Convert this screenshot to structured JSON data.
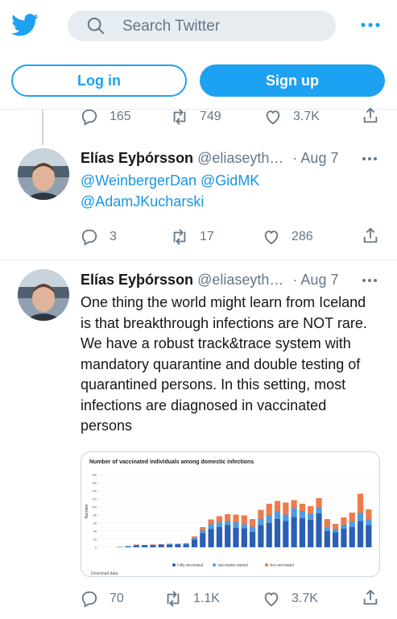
{
  "header": {
    "search_placeholder": "Search Twitter"
  },
  "auth": {
    "login_label": "Log in",
    "signup_label": "Sign up"
  },
  "prev_tweet_actions": {
    "replies": "165",
    "retweets": "749",
    "likes": "3.7K"
  },
  "tweets": [
    {
      "name": "Elías Eyþórsson",
      "handle": "@eliaseyth…",
      "date": "· Aug 7",
      "mention1": "@WeinbergerDan",
      "mention2": "@GidMK",
      "mention3": "@AdamJKucharski",
      "replies": "3",
      "retweets": "17",
      "likes": "286"
    },
    {
      "name": "Elías Eyþórsson",
      "handle": "@eliaseyth…",
      "date": "· Aug 7",
      "text": "One thing the world might learn from Iceland is that breakthrough infections are NOT rare. We have a robust track&trace system with mandatory quarantine and double testing of quarantined persons. In this setting, most infections are diagnosed in vaccinated persons",
      "replies": "70",
      "retweets": "1.1K",
      "likes": "3.7K"
    }
  ],
  "chart_data": {
    "type": "bar",
    "title": "Number of vaccinated individuals among domestic infections",
    "ylabel": "Number",
    "ylim": [
      0,
      180
    ],
    "yticks": [
      0,
      20,
      40,
      60,
      80,
      100,
      120,
      140,
      160,
      180
    ],
    "legend": [
      "Fully vaccinated",
      "Vaccination started",
      "Not vaccinated"
    ],
    "colors": {
      "fully": "#2b5fb4",
      "started": "#4e9be0",
      "not": "#ee7b4a"
    },
    "series": [
      {
        "name": "Fully vaccinated",
        "values": [
          0,
          0,
          1,
          2,
          4,
          5,
          5,
          6,
          6,
          7,
          7,
          19,
          35,
          45,
          50,
          55,
          48,
          47,
          38,
          55,
          60,
          70,
          65,
          75,
          72,
          68,
          84,
          40,
          37,
          46,
          50,
          65,
          55
        ]
      },
      {
        "name": "Vaccination started",
        "values": [
          0,
          0,
          0,
          1,
          2,
          1,
          1,
          1,
          2,
          1,
          2,
          4,
          7,
          12,
          12,
          10,
          14,
          10,
          13,
          16,
          20,
          20,
          16,
          22,
          18,
          16,
          14,
          10,
          8,
          10,
          14,
          20,
          14
        ]
      },
      {
        "name": "Not vaccinated",
        "values": [
          0,
          0,
          0,
          0,
          1,
          0,
          1,
          1,
          1,
          1,
          1,
          4,
          8,
          12,
          15,
          17,
          19,
          22,
          19,
          22,
          28,
          25,
          30,
          20,
          18,
          18,
          24,
          20,
          13,
          18,
          22,
          48,
          25
        ]
      }
    ],
    "bottom_text": "Download data"
  }
}
